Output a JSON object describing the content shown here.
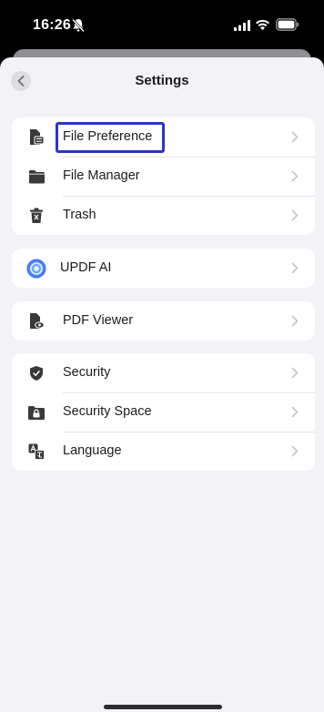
{
  "status_bar": {
    "time": "16:26"
  },
  "nav": {
    "title": "Settings"
  },
  "groups": [
    {
      "items": [
        {
          "label": "File Preference",
          "icon": "file-preference-icon",
          "highlighted": true
        },
        {
          "label": "File Manager",
          "icon": "folder-icon"
        },
        {
          "label": "Trash",
          "icon": "trash-icon"
        }
      ]
    },
    {
      "items": [
        {
          "label": "UPDF AI",
          "icon": "updf-ai-icon"
        }
      ]
    },
    {
      "items": [
        {
          "label": "PDF Viewer",
          "icon": "pdf-viewer-icon"
        }
      ]
    },
    {
      "items": [
        {
          "label": "Security",
          "icon": "shield-icon"
        },
        {
          "label": "Security Space",
          "icon": "lock-folder-icon"
        },
        {
          "label": "Language",
          "icon": "language-icon"
        }
      ]
    }
  ],
  "colors": {
    "highlight": "#2b35c7",
    "sheet_background": "#f2f2f7",
    "ai_icon": "#3a8df0"
  }
}
